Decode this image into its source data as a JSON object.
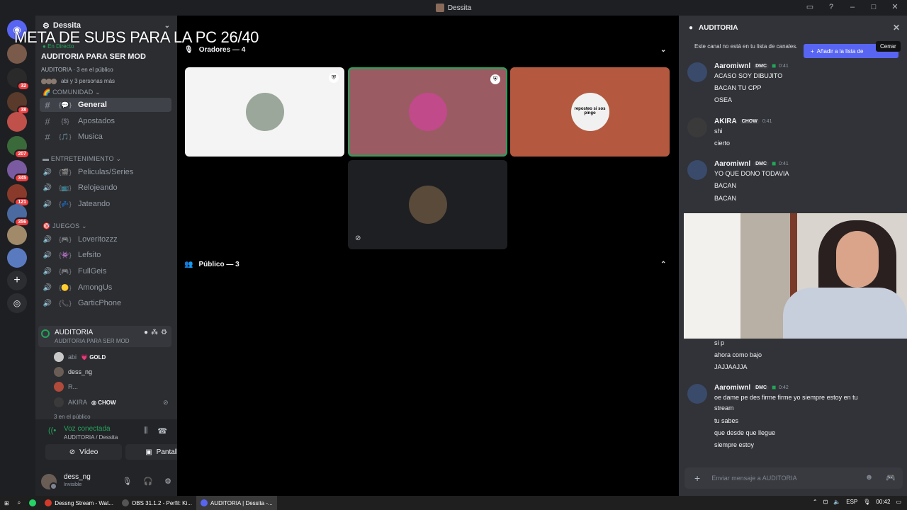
{
  "titlebar": {
    "title": "Dessita"
  },
  "overlay_text": "META DE SUBS PARA LA PC 26/40",
  "servers": {
    "badges": [
      "32",
      "38",
      "207",
      "345",
      "121",
      "356"
    ]
  },
  "sidebar": {
    "server_name": "Dessita",
    "live": "En Directo",
    "stage_title": "AUDITORIA PARA SER MOD",
    "public_line": "AUDITORIA · 3 en el público",
    "people_line": "abi y 3 personas más",
    "categories": [
      {
        "label": "COMUNIDAD"
      },
      {
        "label": "ENTRETENIMIENTO"
      },
      {
        "label": "JUEGOS"
      }
    ],
    "channels": [
      {
        "label": "General",
        "emoji": "{💬}",
        "icon": "#"
      },
      {
        "label": "Apostados",
        "emoji": "{$}",
        "icon": "#"
      },
      {
        "label": "Musica",
        "emoji": "{🎵}",
        "icon": "#"
      },
      {
        "label": "Peliculas/Series",
        "emoji": "{🎬}",
        "icon": "🔊"
      },
      {
        "label": "Relojeando",
        "emoji": "{📺}",
        "icon": "🔊"
      },
      {
        "label": "Jateando",
        "emoji": "{💤}",
        "icon": "🔊"
      },
      {
        "label": "Loveritozzz",
        "emoji": "{🎮}",
        "icon": "🔊"
      },
      {
        "label": "Lefsito",
        "emoji": "{👾}",
        "icon": "🔊"
      },
      {
        "label": "FullGeis",
        "emoji": "{🎮}",
        "icon": "🔊"
      },
      {
        "label": "AmongUs",
        "emoji": "{🟡}",
        "icon": "🔊"
      },
      {
        "label": "GarticPhone",
        "emoji": "{📞}",
        "icon": "🔊"
      }
    ],
    "voice_channel": {
      "name": "AUDITORIA",
      "sub": "AUDITORIA PARA SER MOD"
    },
    "voice_members": [
      {
        "name": "abi",
        "tag": "💗 GOLD"
      },
      {
        "name": "dess_ng",
        "tag": ""
      },
      {
        "name": "R...",
        "tag": ""
      },
      {
        "name": "AKIRA",
        "tag": "◎ CHOW"
      }
    ],
    "public_count": "3 en el público"
  },
  "voice_panel": {
    "status": "Voz conectada",
    "location": "AUDITORIA / Dessita",
    "video_label": "Vídeo",
    "screen_label": "Pantalla"
  },
  "user": {
    "name": "dess_ng",
    "status": "Invisible"
  },
  "stage": {
    "speakers_label": "Oradores — 4",
    "public_label": "Público — 3",
    "tiles": [
      {
        "bg": "#f4f4f4",
        "avatar_color": "#9aa79a",
        "mod": true
      },
      {
        "bg": "#9a5c62",
        "avatar_color": "#c04a8a",
        "mod": true
      },
      {
        "bg": "#b4593f",
        "avatar_color": "#f1f1f1",
        "mod": false
      },
      {
        "bg": "#1e1f22",
        "avatar_color": "#5a4a3a",
        "mod": false
      }
    ],
    "tile3_caption": "reposteo si sos pingo"
  },
  "chat": {
    "channel": "AUDITORIA",
    "notice": "Este canal no está en tu lista de canales.",
    "add_button": "Añadir a la lista de",
    "tooltip": "Cerrar",
    "messages": [
      {
        "author": "Aaromiwnl",
        "badge": "DMC",
        "time": "0:41",
        "lines": [
          "ACASO SOY DIBUJITO",
          "BACAN TU CPP",
          "OSEA"
        ]
      },
      {
        "author": "AKIRA",
        "badge": "CHOW",
        "time": "0:41",
        "lines": [
          "shi",
          "cierto"
        ]
      },
      {
        "author": "Aaromiwnl",
        "badge": "DMC",
        "time": "0:41",
        "lines": [
          "YO QUE DONO TODAVIA",
          "BACAN",
          "BACAN"
        ]
      },
      {
        "author": "",
        "badge": "",
        "time": "",
        "lines": [
          "si p",
          "ahora como bajo",
          "JAJJAAJJA"
        ]
      },
      {
        "author": "Aaromiwnl",
        "badge": "DMC",
        "time": "0:42",
        "lines": [
          "oe dame pe des firme firme yo siempre estoy en tu",
          "stream",
          "tu sabes",
          "que desde que llegue",
          "siempre estoy"
        ]
      }
    ],
    "composer_placeholder": "Enviar mensaje a AUDITORIA"
  },
  "taskbar": {
    "items": [
      "Dessng Stream - Wat...",
      "OBS 31.1.2 - Perfil: Ki...",
      "AUDITORIA | Dessita -..."
    ],
    "lang": "ESP",
    "time": "00:42"
  }
}
